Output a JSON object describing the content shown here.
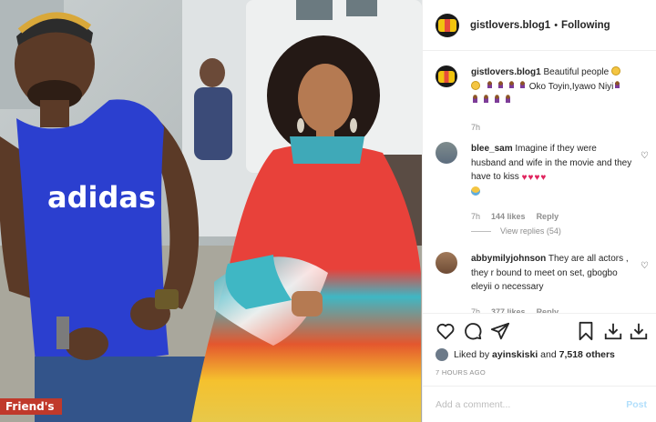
{
  "header": {
    "username": "gistlovers.blog1",
    "separator": "•",
    "follow_label": "Following"
  },
  "caption": {
    "username": "gistlovers.blog1",
    "text_start": "Beautiful people",
    "text_names": "Oko Toyin,Iyawo Niyi",
    "time": "7h"
  },
  "comments": [
    {
      "username": "blee_sam",
      "text": "Imagine if they were husband and wife in the movie and they have to kiss",
      "time": "7h",
      "likes": "144 likes",
      "reply": "Reply",
      "view_replies": "View replies (54)"
    },
    {
      "username": "abbymilyjohnson",
      "text": "They are all actors , they r bound to meet on set, gbogbo eleyii o necessary",
      "time": "7h",
      "likes": "377 likes",
      "reply": "Reply"
    }
  ],
  "likes": {
    "prefix": "Liked by",
    "user": "ayinskiski",
    "and": "and",
    "others": "7,518 others"
  },
  "post_time": "7 HOURS AGO",
  "add_comment": {
    "placeholder": "Add a comment...",
    "post_label": "Post"
  },
  "photo": {
    "shirt_text": "adidas",
    "watermark": "Friend's"
  },
  "icons": [
    "heart-icon",
    "comment-icon",
    "share-icon",
    "bookmark-icon",
    "download-icon",
    "download-icon"
  ]
}
